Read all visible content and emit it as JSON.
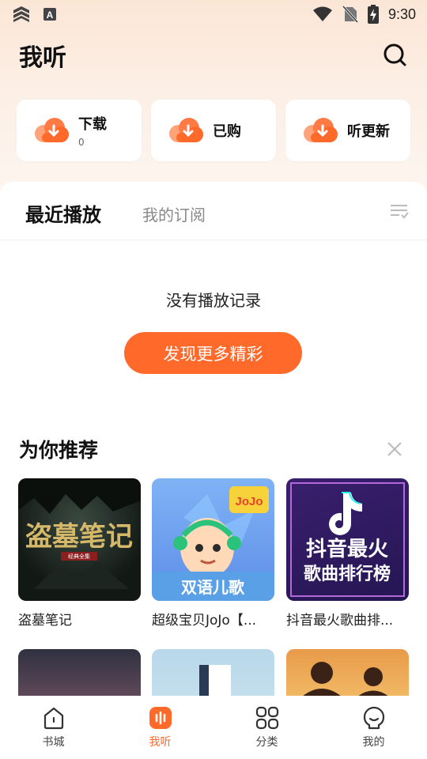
{
  "status_bar": {
    "time": "9:30"
  },
  "header": {
    "title": "我听"
  },
  "quick_cards": [
    {
      "label": "下载",
      "count": "0"
    },
    {
      "label": "已购"
    },
    {
      "label": "听更新"
    }
  ],
  "tabs": {
    "active": "最近播放",
    "other": "我的订阅"
  },
  "empty_state": {
    "message": "没有播放记录",
    "button": "发现更多精彩"
  },
  "recommend": {
    "title": "为你推荐",
    "items": [
      {
        "title": "盗墓笔记",
        "cover_text": "盗墓笔记",
        "cover_sub": "经典全集"
      },
      {
        "title": "超级宝贝JoJo【...",
        "cover_text": "双语儿歌",
        "cover_badge": "JoJo"
      },
      {
        "title": "抖音最火歌曲排...",
        "cover_line1": "抖音最火",
        "cover_line2": "歌曲排行榜"
      },
      {
        "title": ""
      },
      {
        "title": ""
      },
      {
        "title": ""
      }
    ]
  },
  "bottom_nav": [
    {
      "label": "书城",
      "icon": "home-icon"
    },
    {
      "label": "我听",
      "icon": "listen-icon",
      "active": true
    },
    {
      "label": "分类",
      "icon": "grid-icon"
    },
    {
      "label": "我的",
      "icon": "profile-icon"
    }
  ],
  "colors": {
    "accent": "#ff6a2b",
    "background_top": "#fbe6d6"
  }
}
